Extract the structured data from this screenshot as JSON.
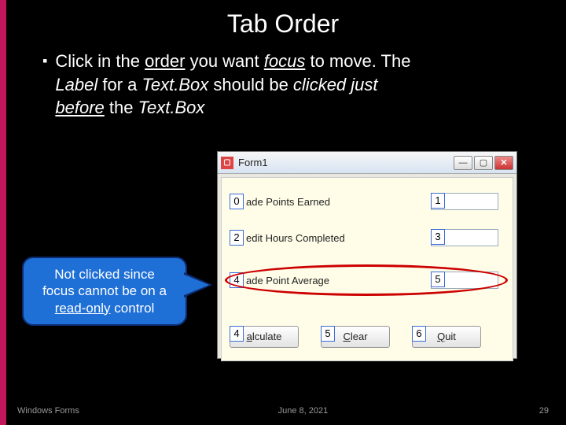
{
  "title": "Tab Order",
  "bullet": {
    "prefix": "▪",
    "p1a": "Click in the ",
    "p1b": "order",
    "p1c": " you want ",
    "p1d": "focus",
    "p1e": " to move.  The ",
    "p2a": "Label",
    "p2b": " for a ",
    "p2c": "Text.Box",
    "p2d": " should be ",
    "p2e": "clicked just",
    "p3a": "before",
    "p3b": " the ",
    "p3c": "Text.Box"
  },
  "callout": {
    "l1": "Not clicked since",
    "l2": "focus cannot be on a",
    "l3a": "read-only",
    "l3b": " control"
  },
  "form": {
    "title": "Form1",
    "rows": [
      {
        "tab_label": "0",
        "label": "ade Points Earned",
        "tab_box": "1"
      },
      {
        "tab_label": "2",
        "label": "edit Hours Completed",
        "tab_box": "3"
      },
      {
        "tab_label": "4",
        "label": "ade Point Average",
        "tab_box": "5"
      }
    ],
    "buttons": [
      {
        "tab": "4",
        "u": "a",
        "rest": "lculate"
      },
      {
        "tab": "5",
        "u": "C",
        "rest": "lear"
      },
      {
        "tab": "6",
        "u": "Q",
        "rest": "uit"
      }
    ]
  },
  "footer": {
    "left": "Windows Forms",
    "center": "June 8, 2021",
    "right": "29"
  }
}
